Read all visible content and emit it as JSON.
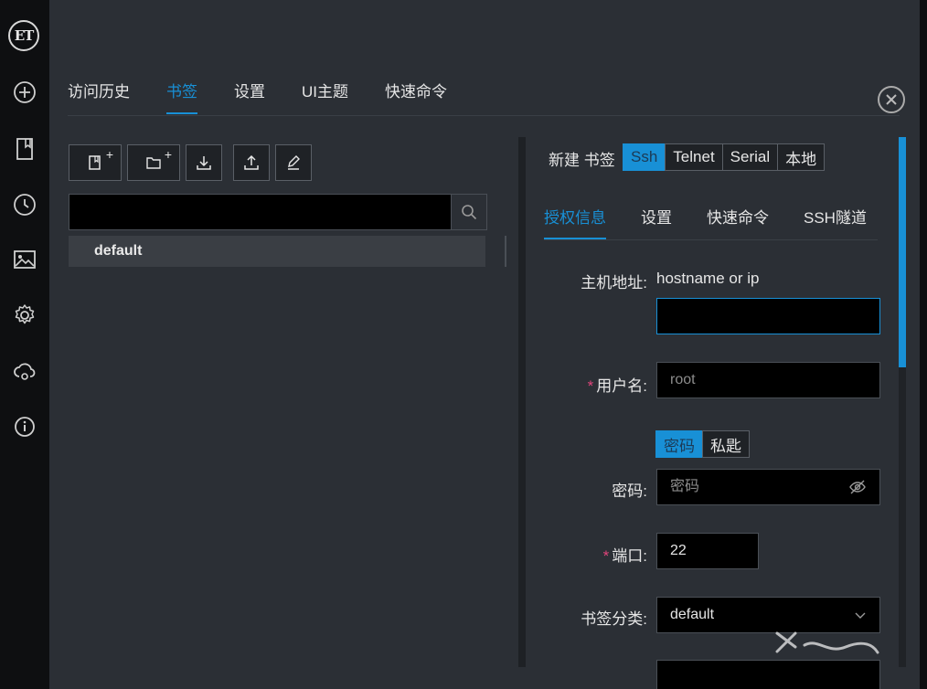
{
  "logo": {
    "text": "ET"
  },
  "rail": {
    "items": [
      {
        "name": "add-icon"
      },
      {
        "name": "bookmark-icon"
      },
      {
        "name": "history-icon"
      },
      {
        "name": "image-icon"
      },
      {
        "name": "gear-icon"
      },
      {
        "name": "cloud-sync-icon"
      },
      {
        "name": "info-icon"
      }
    ]
  },
  "top_tabs": [
    {
      "label": "访问历史",
      "active": false
    },
    {
      "label": "书签",
      "active": true
    },
    {
      "label": "设置",
      "active": false
    },
    {
      "label": "UI主题",
      "active": false
    },
    {
      "label": "快速命令",
      "active": false
    }
  ],
  "toolbar": {
    "plus": "+",
    "new_bookmark_icon": "bookmark-plus-icon",
    "new_folder_icon": "folder-plus-icon",
    "import_icon": "import-icon",
    "export_icon": "export-icon",
    "edit_icon": "edit-icon"
  },
  "search": {
    "value": "",
    "placeholder": ""
  },
  "tree": {
    "items": [
      {
        "label": "default"
      }
    ]
  },
  "new_bookmark": {
    "label": "新建 书签",
    "types": [
      {
        "label": "Ssh",
        "active": true
      },
      {
        "label": "Telnet",
        "active": false
      },
      {
        "label": "Serial",
        "active": false
      },
      {
        "label": "本地",
        "active": false
      }
    ]
  },
  "sub_tabs": [
    {
      "label": "授权信息",
      "active": true
    },
    {
      "label": "设置",
      "active": false
    },
    {
      "label": "快速命令",
      "active": false
    },
    {
      "label": "SSH隧道",
      "active": false
    }
  ],
  "form": {
    "host_label": "主机地址:",
    "host_hint": "hostname or ip",
    "host_value": "",
    "required_mark": "*",
    "username_label": "用户名:",
    "username_placeholder": "root",
    "auth_types": [
      {
        "label": "密码",
        "active": true
      },
      {
        "label": "私匙",
        "active": false
      }
    ],
    "password_label": "密码:",
    "password_placeholder": "密码",
    "port_label": "端口:",
    "port_value": "22",
    "category_label": "书签分类:",
    "category_value": "default"
  },
  "colors": {
    "accent": "#1890d6",
    "required": "#e0457b",
    "background": "#2b2f35",
    "rail": "#0e0f11"
  }
}
